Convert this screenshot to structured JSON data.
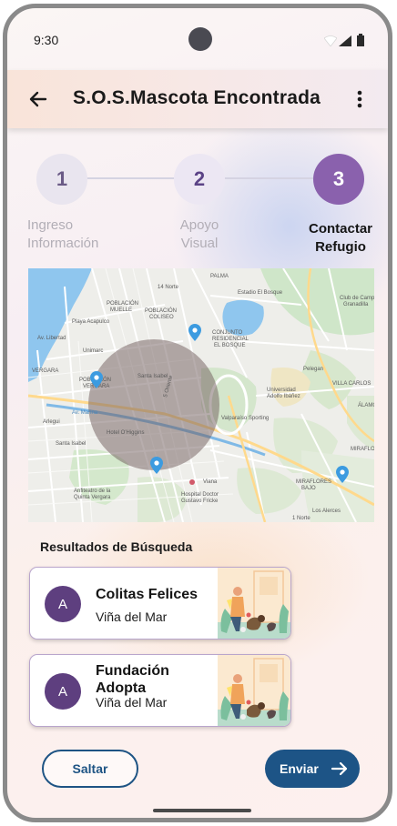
{
  "status_bar": {
    "time": "9:30",
    "icons": [
      "wifi-icon",
      "signal-icon",
      "battery-icon"
    ]
  },
  "app_bar": {
    "back_icon": "arrow-back-icon",
    "title": "S.O.S.Mascota Encontrada",
    "menu_icon": "more-vert-icon"
  },
  "stepper": {
    "steps": [
      {
        "number": "1",
        "label_line1": "Ingreso",
        "label_line2": "Información",
        "state": "done"
      },
      {
        "number": "2",
        "label_line1": "Apoyo",
        "label_line2": "Visual",
        "state": "done"
      },
      {
        "number": "3",
        "label_line1": "Contactar",
        "label_line2": "Refugio",
        "state": "active"
      }
    ],
    "active_color": "#8a61ad"
  },
  "map": {
    "labels": [
      "14 Norte",
      "Estadio El Bosque",
      "Club de Campo Granadilla",
      "POBLACIÓN MUELLE",
      "POBLACIÓN COLISEO",
      "Playa Acapulco",
      "Unimarc",
      "CONJUNTO RESIDENCIAL EL BOSQUE",
      "Santa Isabel",
      "Universidad Adolfo Ibáñez",
      "VILLA CARLOS",
      "POBLACIÓN VERGARA",
      "Valparaíso Sporting",
      "Arlegui",
      "Hotel O'Higgins",
      "Santa Isabel",
      "Viana",
      "MIRAFLORES BAJO",
      "Hospital Doctor Gustavo Fricke",
      "1 Norte",
      "Los Alerces",
      "MIRAFLO",
      "Anfiteatro de la Quinta Vergara",
      "Av. Marina",
      "Av. Libertad",
      "5 Oriente",
      "VERGARA",
      "PALMA",
      "Pelegan",
      "ÁLAMOS"
    ],
    "pins": 4
  },
  "results": {
    "heading": "Resultados de Búsqueda",
    "items": [
      {
        "avatar_letter": "A",
        "name": "Colitas Felices",
        "city": "Viña del Mar",
        "image": "volunteer-with-dogs-illustration"
      },
      {
        "avatar_letter": "A",
        "name": "Fundación Adopta",
        "city": "Viña del Mar",
        "image": "volunteer-with-dogs-illustration"
      }
    ]
  },
  "actions": {
    "skip_label": "Saltar",
    "send_label": "Enviar",
    "send_icon": "arrow-right-icon"
  },
  "colors": {
    "primary": "#1d5486",
    "accent": "#8a61ad",
    "avatar": "#5e3f7f"
  }
}
